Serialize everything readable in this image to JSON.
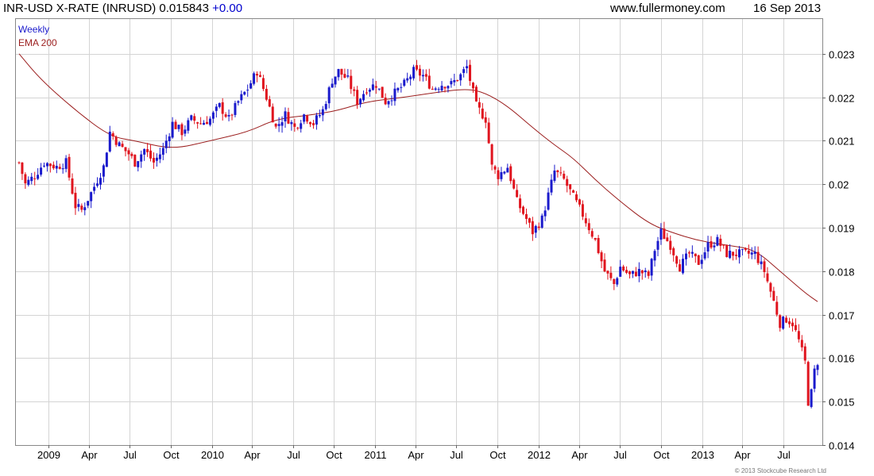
{
  "header": {
    "symbol_text": "INR-USD X-RATE (INRUSD) 0.015843",
    "change_text": "+0.00",
    "site": "www.fullermoney.com",
    "date": "16 Sep 2013"
  },
  "footer": {
    "copyright": "© 2013 Stockcube Research Ltd"
  },
  "colors": {
    "up": "#1a1acc",
    "down": "#e0141e",
    "ema": "#9b1e1e",
    "grid": "#d4d4d4"
  },
  "chart_data": {
    "type": "candlestick",
    "title": "INR-USD X-RATE (INRUSD)",
    "legend": {
      "placement": "top-left",
      "entries": [
        "Weekly",
        "EMA 200"
      ]
    },
    "xlim": [
      "2008-10-27",
      "2013-09-16"
    ],
    "ylim": [
      0.014,
      0.0238
    ],
    "y_ticks": [
      0.014,
      0.015,
      0.016,
      0.017,
      0.018,
      0.019,
      0.02,
      0.021,
      0.022,
      0.023
    ],
    "y_tick_labels": [
      "0.014",
      "0.015",
      "0.016",
      "0.017",
      "0.018",
      "0.019",
      "0.02",
      "0.021",
      "0.022",
      "0.023"
    ],
    "x_ticks": [
      {
        "label": "2009",
        "date": "2009-01-01"
      },
      {
        "label": "Apr",
        "date": "2009-04-01"
      },
      {
        "label": "Jul",
        "date": "2009-07-01"
      },
      {
        "label": "Oct",
        "date": "2009-10-01"
      },
      {
        "label": "2010",
        "date": "2010-01-01"
      },
      {
        "label": "Apr",
        "date": "2010-04-01"
      },
      {
        "label": "Jul",
        "date": "2010-07-01"
      },
      {
        "label": "Oct",
        "date": "2010-10-01"
      },
      {
        "label": "2011",
        "date": "2011-01-01"
      },
      {
        "label": "Apr",
        "date": "2011-04-01"
      },
      {
        "label": "Jul",
        "date": "2011-07-01"
      },
      {
        "label": "Oct",
        "date": "2011-10-01"
      },
      {
        "label": "2012",
        "date": "2012-01-01"
      },
      {
        "label": "Apr",
        "date": "2012-04-01"
      },
      {
        "label": "Jul",
        "date": "2012-07-01"
      },
      {
        "label": "Oct",
        "date": "2012-10-01"
      },
      {
        "label": "2013",
        "date": "2013-01-01"
      },
      {
        "label": "Apr",
        "date": "2013-04-01"
      },
      {
        "label": "Jul",
        "date": "2013-07-01"
      }
    ],
    "close_anchors": [
      [
        "2008-10-27",
        0.0205
      ],
      [
        "2008-11-10",
        0.02
      ],
      [
        "2008-12-01",
        0.0202
      ],
      [
        "2008-12-22",
        0.0205
      ],
      [
        "2009-01-19",
        0.0204
      ],
      [
        "2009-02-09",
        0.0205
      ],
      [
        "2009-03-02",
        0.0195
      ],
      [
        "2009-03-16",
        0.0194
      ],
      [
        "2009-04-06",
        0.0198
      ],
      [
        "2009-05-04",
        0.0204
      ],
      [
        "2009-05-18",
        0.0212
      ],
      [
        "2009-06-08",
        0.0209
      ],
      [
        "2009-06-29",
        0.0207
      ],
      [
        "2009-07-13",
        0.0205
      ],
      [
        "2009-08-03",
        0.0208
      ],
      [
        "2009-08-24",
        0.0205
      ],
      [
        "2009-09-14",
        0.0208
      ],
      [
        "2009-10-05",
        0.0214
      ],
      [
        "2009-10-26",
        0.0212
      ],
      [
        "2009-11-16",
        0.0215
      ],
      [
        "2009-12-07",
        0.0214
      ],
      [
        "2009-12-28",
        0.0215
      ],
      [
        "2010-01-18",
        0.0218
      ],
      [
        "2010-02-08",
        0.0215
      ],
      [
        "2010-03-01",
        0.0219
      ],
      [
        "2010-03-22",
        0.0222
      ],
      [
        "2010-04-12",
        0.0226
      ],
      [
        "2010-05-03",
        0.022
      ],
      [
        "2010-05-24",
        0.0213
      ],
      [
        "2010-06-14",
        0.0216
      ],
      [
        "2010-07-05",
        0.0213
      ],
      [
        "2010-07-26",
        0.0216
      ],
      [
        "2010-08-16",
        0.0214
      ],
      [
        "2010-09-06",
        0.0217
      ],
      [
        "2010-09-27",
        0.0224
      ],
      [
        "2010-10-11",
        0.0226
      ],
      [
        "2010-11-01",
        0.0224
      ],
      [
        "2010-11-22",
        0.0219
      ],
      [
        "2010-12-13",
        0.0222
      ],
      [
        "2011-01-03",
        0.0223
      ],
      [
        "2011-01-24",
        0.0219
      ],
      [
        "2011-02-14",
        0.0221
      ],
      [
        "2011-03-07",
        0.0223
      ],
      [
        "2011-03-28",
        0.0226
      ],
      [
        "2011-04-18",
        0.0225
      ],
      [
        "2011-05-09",
        0.0222
      ],
      [
        "2011-05-30",
        0.0223
      ],
      [
        "2011-06-20",
        0.0223
      ],
      [
        "2011-07-11",
        0.0225
      ],
      [
        "2011-07-25",
        0.0227
      ],
      [
        "2011-08-15",
        0.0218
      ],
      [
        "2011-09-05",
        0.0215
      ],
      [
        "2011-09-19",
        0.0204
      ],
      [
        "2011-10-03",
        0.0202
      ],
      [
        "2011-10-24",
        0.0204
      ],
      [
        "2011-11-14",
        0.0196
      ],
      [
        "2011-12-05",
        0.0192
      ],
      [
        "2011-12-19",
        0.0189
      ],
      [
        "2012-01-09",
        0.0192
      ],
      [
        "2012-02-06",
        0.0203
      ],
      [
        "2012-02-27",
        0.0201
      ],
      [
        "2012-03-19",
        0.0197
      ],
      [
        "2012-04-09",
        0.0193
      ],
      [
        "2012-05-07",
        0.0187
      ],
      [
        "2012-05-28",
        0.018
      ],
      [
        "2012-06-18",
        0.0177
      ],
      [
        "2012-07-02",
        0.0181
      ],
      [
        "2012-07-23",
        0.0179
      ],
      [
        "2012-08-13",
        0.018
      ],
      [
        "2012-09-03",
        0.0179
      ],
      [
        "2012-09-17",
        0.0185
      ],
      [
        "2012-10-01",
        0.0189
      ],
      [
        "2012-10-22",
        0.0186
      ],
      [
        "2012-11-12",
        0.0181
      ],
      [
        "2012-12-03",
        0.0184
      ],
      [
        "2012-12-24",
        0.0182
      ],
      [
        "2013-01-14",
        0.0186
      ],
      [
        "2013-02-04",
        0.0187
      ],
      [
        "2013-02-25",
        0.0184
      ],
      [
        "2013-03-18",
        0.0184
      ],
      [
        "2013-04-08",
        0.0184
      ],
      [
        "2013-04-29",
        0.0184
      ],
      [
        "2013-05-20",
        0.018
      ],
      [
        "2013-06-10",
        0.0173
      ],
      [
        "2013-06-24",
        0.0168
      ],
      [
        "2013-07-08",
        0.0169
      ],
      [
        "2013-07-22",
        0.0168
      ],
      [
        "2013-08-05",
        0.0164
      ],
      [
        "2013-08-19",
        0.0159
      ],
      [
        "2013-08-26",
        0.015
      ],
      [
        "2013-09-02",
        0.0152
      ],
      [
        "2013-09-09",
        0.0157
      ],
      [
        "2013-09-16",
        0.01584
      ]
    ],
    "ema_200": [
      [
        "2008-10-27",
        0.023
      ],
      [
        "2008-12-15",
        0.0224
      ],
      [
        "2009-03-02",
        0.0217
      ],
      [
        "2009-05-18",
        0.0211
      ],
      [
        "2009-07-13",
        0.021
      ],
      [
        "2009-10-05",
        0.0208
      ],
      [
        "2009-12-28",
        0.021
      ],
      [
        "2010-03-22",
        0.0212
      ],
      [
        "2010-05-24",
        0.0215
      ],
      [
        "2010-08-16",
        0.0216
      ],
      [
        "2010-10-11",
        0.0217
      ],
      [
        "2010-12-13",
        0.0219
      ],
      [
        "2011-03-07",
        0.022
      ],
      [
        "2011-05-09",
        0.0221
      ],
      [
        "2011-07-25",
        0.0222
      ],
      [
        "2011-09-05",
        0.0221
      ],
      [
        "2011-10-24",
        0.0218
      ],
      [
        "2011-12-19",
        0.0213
      ],
      [
        "2012-02-06",
        0.0209
      ],
      [
        "2012-03-19",
        0.0206
      ],
      [
        "2012-05-07",
        0.0201
      ],
      [
        "2012-07-02",
        0.0196
      ],
      [
        "2012-09-03",
        0.0191
      ],
      [
        "2012-10-22",
        0.0189
      ],
      [
        "2012-12-24",
        0.0187
      ],
      [
        "2013-02-25",
        0.0186
      ],
      [
        "2013-04-29",
        0.0185
      ],
      [
        "2013-06-24",
        0.018
      ],
      [
        "2013-08-19",
        0.0175
      ],
      [
        "2013-09-16",
        0.0173
      ]
    ]
  }
}
